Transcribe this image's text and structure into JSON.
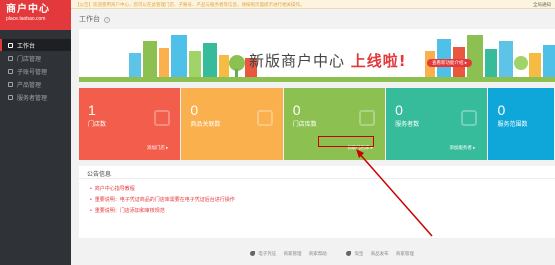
{
  "logo": {
    "title": "商户中心",
    "subtitle": "place.taobao.com"
  },
  "sidebar": {
    "items": [
      {
        "label": "工作台",
        "icon": "desktop-icon",
        "active": true
      },
      {
        "label": "门店管理",
        "icon": "store-icon"
      },
      {
        "label": "子账号管理",
        "icon": "user-icon"
      },
      {
        "label": "产品管理",
        "icon": "box-icon"
      },
      {
        "label": "服务者管理",
        "icon": "people-icon"
      }
    ]
  },
  "topbar": {
    "notice": "【公告】欢迎使用商户中心，您可以在此管理门店、子账号、产品与服务者等信息，请按照页面提示进行相关操作。",
    "right": "全局通知"
  },
  "breadcrumb": {
    "title": "工作台",
    "help": "?"
  },
  "banner": {
    "text_prefix": "新版商户中心",
    "text_highlight": "上线啦!",
    "button": "查看新功能介绍 ▸"
  },
  "cards": [
    {
      "count": "1",
      "label": "门店数",
      "link": "添加门店 ▸",
      "color": "#f25e4b"
    },
    {
      "count": "0",
      "label": "商品关联数",
      "link": "",
      "color": "#fbb04e"
    },
    {
      "count": "0",
      "label": "门店库数",
      "link": "领取门店库 ▸",
      "color": "#8cc152"
    },
    {
      "count": "0",
      "label": "服务者数",
      "link": "添加服务者 ▸",
      "color": "#37bc9b"
    },
    {
      "count": "0",
      "label": "服务范围数",
      "link": "",
      "color": "#0fa6d9"
    }
  ],
  "notice": {
    "title": "公告信息",
    "items": [
      "商户中心指导教程",
      "重要说明：电子凭证商品的门店库需要在电子凭证后台进行操作",
      "重要说明：门店添加和审核规范"
    ]
  },
  "footer": {
    "left_title": "电子凭证",
    "left_links": [
      "商家管理",
      "商家帮助"
    ],
    "right_title": "淘宝",
    "right_links": [
      "商品发布",
      "商家管理"
    ]
  },
  "colors": {
    "accent": "#e4393c",
    "sidebar": "#2f3237"
  }
}
